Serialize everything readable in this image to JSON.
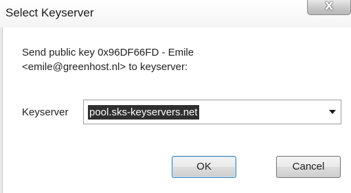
{
  "window": {
    "title": "Select Keyserver",
    "close_glyph": "X"
  },
  "message": {
    "text": "Send public key 0x96DF66FD - Emile\n<emile@greenhost.nl> to keyserver:"
  },
  "keyserver": {
    "label": "Keyserver",
    "selected": "pool.sks-keyservers.net"
  },
  "buttons": {
    "ok": "OK",
    "cancel": "Cancel"
  },
  "icons": {
    "close": "close-icon",
    "dropdown": "chevron-down-icon"
  },
  "colors": {
    "selection_bg": "#2f2f2f",
    "default_button_border": "#3c7fb1"
  }
}
